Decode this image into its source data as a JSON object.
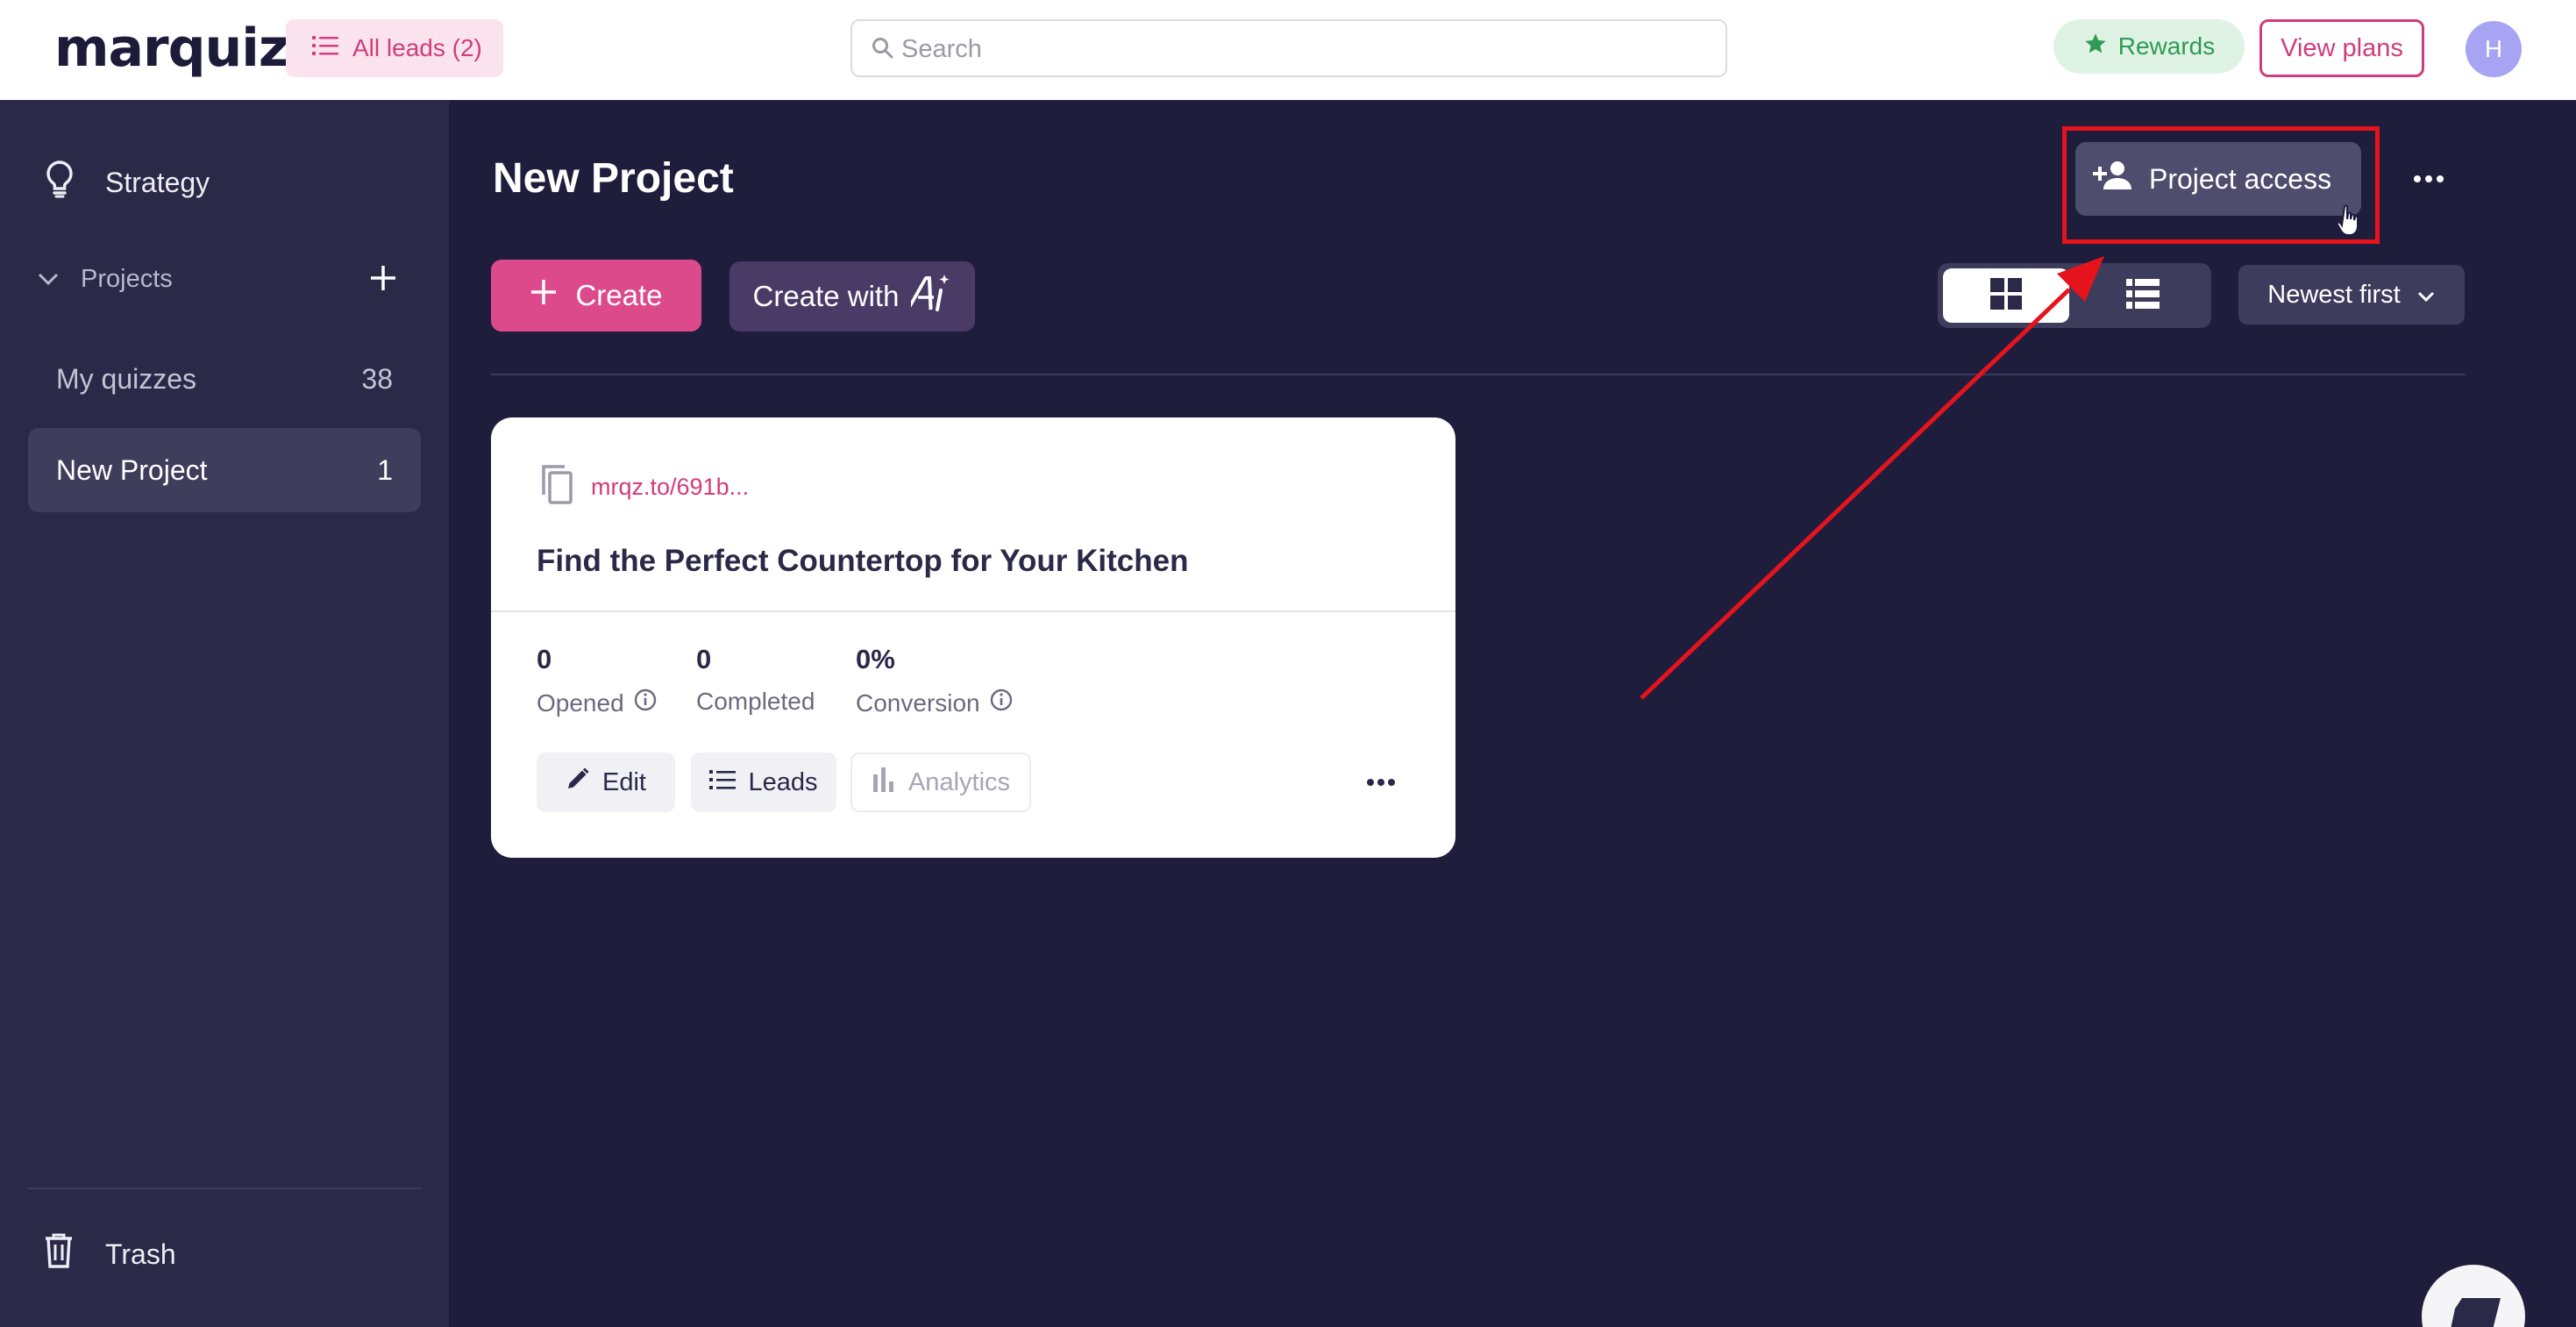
{
  "header": {
    "logo": "marquiz",
    "all_leads_label": "All leads (2)",
    "search_placeholder": "Search",
    "rewards_label": "Rewards",
    "view_plans_label": "View plans",
    "avatar_initial": "H"
  },
  "sidebar": {
    "strategy_label": "Strategy",
    "projects_label": "Projects",
    "items": [
      {
        "label": "My quizzes",
        "count": "38"
      },
      {
        "label": "New Project",
        "count": "1",
        "active": true
      }
    ],
    "trash_label": "Trash"
  },
  "main": {
    "title": "New Project",
    "project_access_label": "Project access",
    "create_label": "Create",
    "create_with_label": "Create with",
    "sort_label": "Newest first"
  },
  "card": {
    "link": "mrqz.to/691b...",
    "title": "Find the Perfect Countertop for Your Kitchen",
    "stats": [
      {
        "value": "0",
        "label": "Opened"
      },
      {
        "value": "0",
        "label": "Completed"
      },
      {
        "value": "0%",
        "label": "Conversion"
      }
    ],
    "edit_label": "Edit",
    "leads_label": "Leads",
    "analytics_label": "Analytics"
  },
  "colors": {
    "brand_pink": "#dc4a8c",
    "background": "#1f1d3c",
    "sidebar": "#2a2948",
    "annotation_red": "#e5141c",
    "rewards_green": "#2e9a55"
  },
  "icons": [
    "list-icon",
    "search-icon",
    "star-icon",
    "lightbulb-icon",
    "chevron-down-icon",
    "plus-icon",
    "trash-icon",
    "person-add-icon",
    "more-horizontal-icon",
    "ai-icon",
    "grid-view-icon",
    "list-view-icon",
    "copy-icon",
    "info-icon",
    "pencil-icon",
    "bar-chart-icon",
    "hand-pointer-icon"
  ]
}
